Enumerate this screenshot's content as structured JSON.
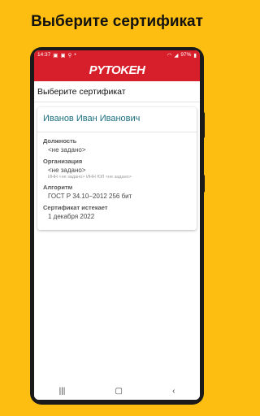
{
  "promo": {
    "title": "Выберите сертификат"
  },
  "status_bar": {
    "time": "14:37",
    "battery": "97%"
  },
  "app": {
    "logo_text": "PYTOKEH"
  },
  "screen": {
    "header": "Выберите сертификат"
  },
  "certificate": {
    "owner": "Иванов Иван Иванович",
    "position_label": "Должность",
    "position_value": "<не задано>",
    "org_label": "Организация",
    "org_value": "<не задано>",
    "org_ids": "ИНН <не задано>  ИНН ЮЛ <не задано>",
    "algorithm_label": "Алгоритм",
    "algorithm_value": "ГОСТ Р 34.10−2012 256 бит",
    "expires_label": "Сертификат истекает",
    "expires_value": "1 декабря 2022"
  },
  "nav": {
    "recents_icon": "recent-apps-icon",
    "home_icon": "home-icon",
    "back_icon": "back-icon"
  },
  "colors": {
    "background": "#FDBE11",
    "brand_red": "#D71F2B",
    "name_teal": "#1a6e7e"
  }
}
